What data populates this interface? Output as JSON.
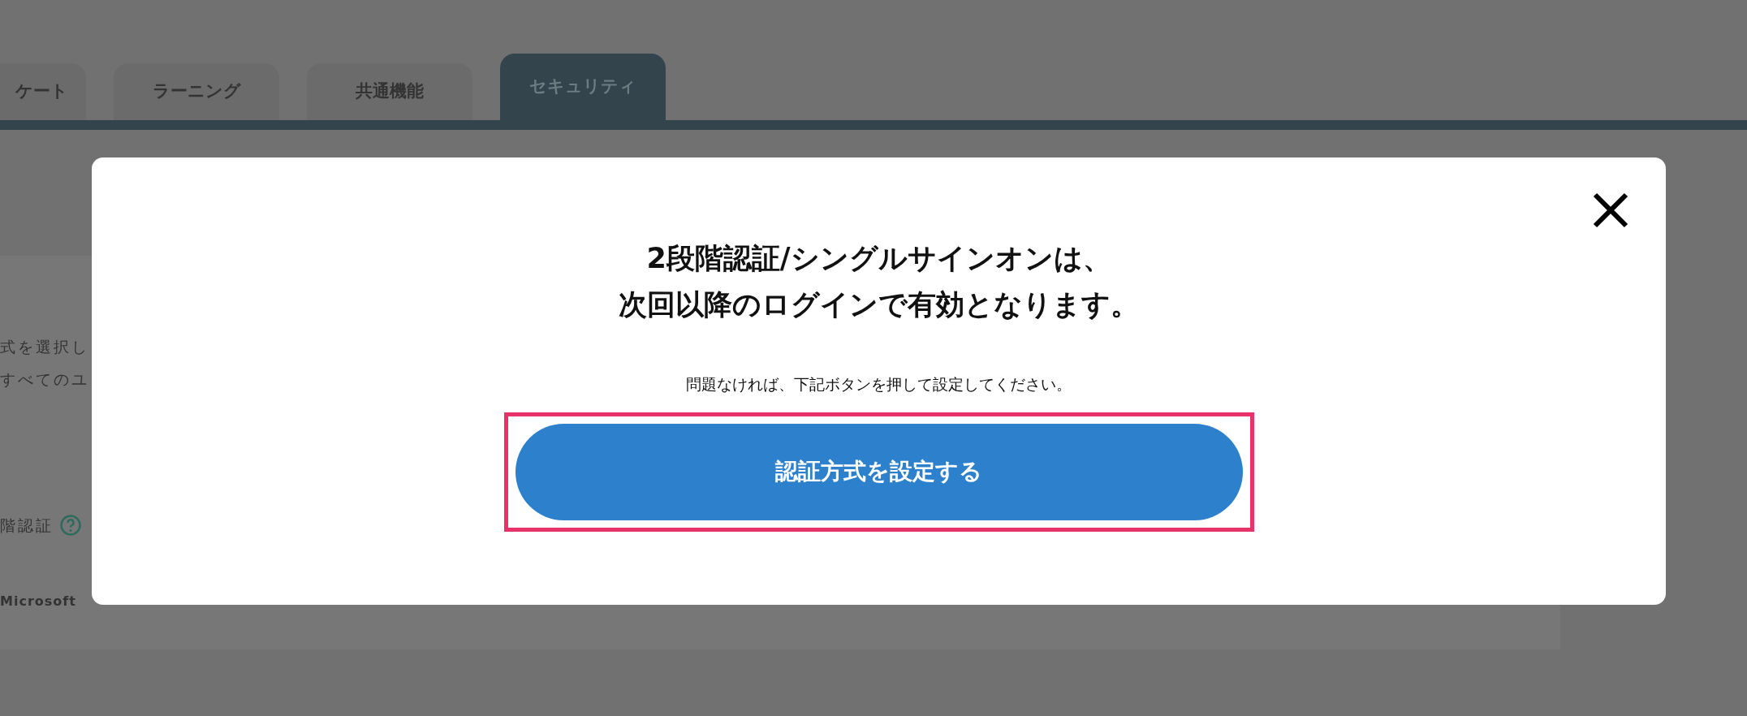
{
  "tabs": [
    {
      "label": "ケート",
      "selected": false
    },
    {
      "label": "ラーニング",
      "selected": false
    },
    {
      "label": "共通機能",
      "selected": false
    },
    {
      "label": "セキュリティ",
      "selected": true
    }
  ],
  "background_panel": {
    "lines": [
      "式を選択し",
      "すべてのユ"
    ],
    "setting_label": "階認証",
    "provider": "Microsoft"
  },
  "modal": {
    "title_lines": [
      "2段階認証/シングルサインオンは、",
      "次回以降のログインで有効となります。"
    ],
    "message": "問題なければ、下記ボタンを押して設定してください。",
    "button": "認証方式を設定する"
  }
}
